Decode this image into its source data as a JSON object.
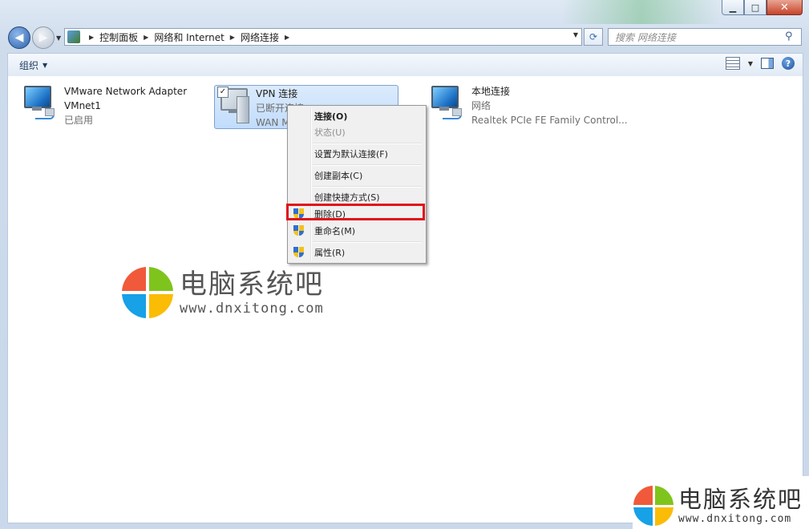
{
  "window": {
    "minimize_glyph": "▁",
    "maximize_glyph": "□",
    "close_glyph": "✕"
  },
  "address": {
    "crumbs": [
      "控制面板",
      "网络和 Internet",
      "网络连接"
    ]
  },
  "search": {
    "placeholder": "搜索 网络连接"
  },
  "toolbar": {
    "organize_label": "组织"
  },
  "connections": [
    {
      "name": "VMware Network Adapter",
      "line2": "VMnet1",
      "line3": "已启用",
      "icon": "network-adapter-icon"
    },
    {
      "name": "VPN 连接",
      "line2": "已断开连接",
      "line3": "WAN M",
      "icon": "vpn-connection-icon",
      "selected": true
    },
    {
      "name": "本地连接",
      "line2": "网络",
      "line3": "Realtek PCIe FE Family Control...",
      "icon": "network-adapter-icon"
    }
  ],
  "context_menu": {
    "items": [
      {
        "label": "连接(O)",
        "bold": true,
        "disabled": false,
        "shield": false
      },
      {
        "label": "状态(U)",
        "bold": false,
        "disabled": true,
        "shield": false
      },
      {
        "label": "设置为默认连接(F)",
        "bold": false,
        "disabled": false,
        "shield": false
      },
      {
        "label": "创建副本(C)",
        "bold": false,
        "disabled": false,
        "shield": false
      },
      {
        "label": "创建快捷方式(S)",
        "bold": false,
        "disabled": false,
        "shield": false
      },
      {
        "label": "删除(D)",
        "bold": false,
        "disabled": false,
        "shield": true,
        "highlighted": true
      },
      {
        "label": "重命名(M)",
        "bold": false,
        "disabled": false,
        "shield": true
      },
      {
        "label": "属性(R)",
        "bold": false,
        "disabled": false,
        "shield": true
      }
    ]
  },
  "watermark": {
    "title": "电脑系统吧",
    "url": "www.dnxitong.com",
    "colors": [
      "#f05a3a",
      "#7fc41c",
      "#17a1e6",
      "#fbbc05"
    ]
  },
  "accent": {
    "highlight_box": "#e0121a",
    "selection": "#c1dcfc"
  }
}
